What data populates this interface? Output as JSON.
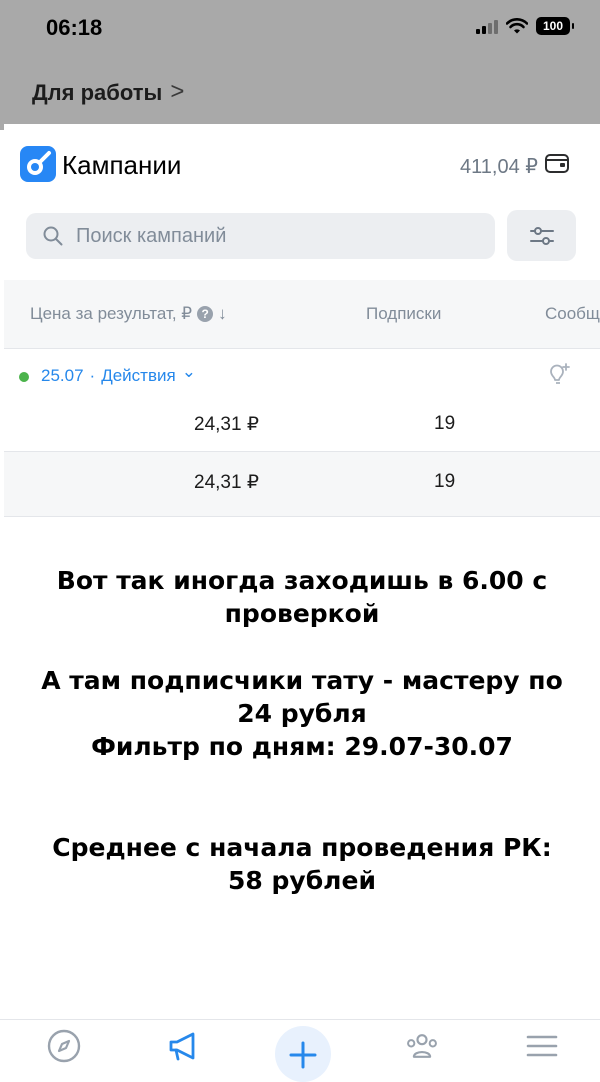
{
  "status_bar": {
    "time": "06:18",
    "battery": "100"
  },
  "workspace": {
    "label": "Для работы",
    "chevron": ">"
  },
  "header": {
    "title": "Кампании",
    "balance": "411,04 ₽"
  },
  "search": {
    "placeholder": "Поиск кампаний"
  },
  "table": {
    "columns": [
      "Цена за результат, ₽",
      "Подписки",
      "Сообщ"
    ],
    "help_glyph": "?",
    "sort_glyph": "↓",
    "group": {
      "date": "25.07",
      "separator": "·",
      "actions": "Действия",
      "chevron": "⌄"
    },
    "rows": [
      {
        "price": "24,31 ₽",
        "subs": "19"
      },
      {
        "price": "24,31 ₽",
        "subs": "19"
      }
    ]
  },
  "overlay": {
    "line1": "Вот так иногда заходишь в 6.00 с",
    "line2": "проверкой",
    "line3": "А там подписчики тату - мастеру по",
    "line4": "24 рубля",
    "line5": "Фильтр по дням: 29.07-30.07",
    "line6": "Среднее с начала проведения РК:",
    "line7": "58 рублей"
  },
  "tabbar": {
    "icons": [
      "compass-icon",
      "megaphone-icon",
      "plus-icon",
      "people-icon",
      "menu-icon"
    ]
  },
  "colors": {
    "accent": "#2688eb",
    "status_green": "#4bb34b",
    "muted": "#818c99"
  }
}
